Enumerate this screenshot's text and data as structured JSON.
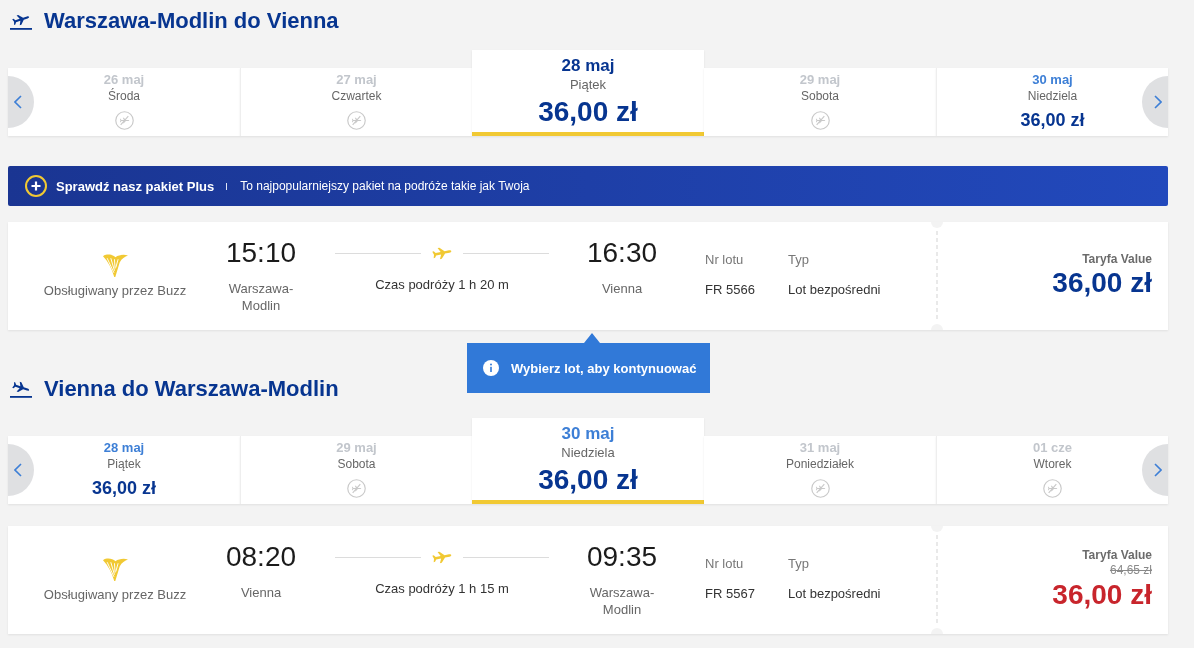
{
  "sections": [
    {
      "kind": "outbound",
      "title": "Warszawa-Modlin do Vienna",
      "dates": [
        {
          "kind": "unavailable",
          "date": "26 maj",
          "weekday": "Środa",
          "selected": false
        },
        {
          "kind": "unavailable",
          "date": "27 maj",
          "weekday": "Czwartek",
          "selected": false
        },
        {
          "kind": "available",
          "date": "28 maj",
          "weekday": "Piątek",
          "price": "36,00 zł",
          "selected": true
        },
        {
          "kind": "unavailable",
          "date": "29 maj",
          "weekday": "Sobota",
          "selected": false
        },
        {
          "kind": "highlighted",
          "date": "30 maj",
          "weekday": "Niedziela",
          "price": "36,00 zł",
          "selected": false
        }
      ],
      "banner": {
        "title": "Sprawdź nasz pakiet Plus",
        "text": "To najpopularniejszy pakiet na podróże takie jak Twoja"
      },
      "flight": {
        "operator": "Obsługiwany przez Buzz",
        "departure_time": "15:10",
        "departure_city": "Warszawa-Modlin",
        "duration": "Czas podróży 1 h 20 m",
        "arrival_time": "16:30",
        "arrival_city": "Vienna",
        "flight_number_label": "Nr lotu",
        "flight_number": "FR 5566",
        "type_label": "Typ",
        "type": "Lot bezpośredni",
        "fare_label": "Taryfa Value",
        "price": "36,00 zł",
        "promo": false
      },
      "tooltip": {
        "text": "Wybierz lot, aby kontynuować"
      }
    },
    {
      "kind": "inbound",
      "title": "Vienna do Warszawa-Modlin",
      "dates": [
        {
          "kind": "highlighted",
          "date": "28 maj",
          "weekday": "Piątek",
          "price": "36,00 zł",
          "selected": false
        },
        {
          "kind": "unavailable",
          "date": "29 maj",
          "weekday": "Sobota",
          "selected": false
        },
        {
          "kind": "highlighted",
          "date": "30 maj",
          "weekday": "Niedziela",
          "price": "36,00 zł",
          "selected": true
        },
        {
          "kind": "unavailable",
          "date": "31 maj",
          "weekday": "Poniedziałek",
          "selected": false
        },
        {
          "kind": "unavailable",
          "date": "01 cze",
          "weekday": "Wtorek",
          "selected": false
        }
      ],
      "flight": {
        "operator": "Obsługiwany przez Buzz",
        "departure_time": "08:20",
        "departure_city": "Vienna",
        "duration": "Czas podróży 1 h 15 m",
        "arrival_time": "09:35",
        "arrival_city": "Warszawa-Modlin",
        "flight_number_label": "Nr lotu",
        "flight_number": "FR 5567",
        "type_label": "Typ",
        "type": "Lot bezpośredni",
        "fare_label": "Taryfa Value",
        "old_price": "64,65 zł",
        "price": "36,00 zł",
        "promo": true
      }
    }
  ]
}
